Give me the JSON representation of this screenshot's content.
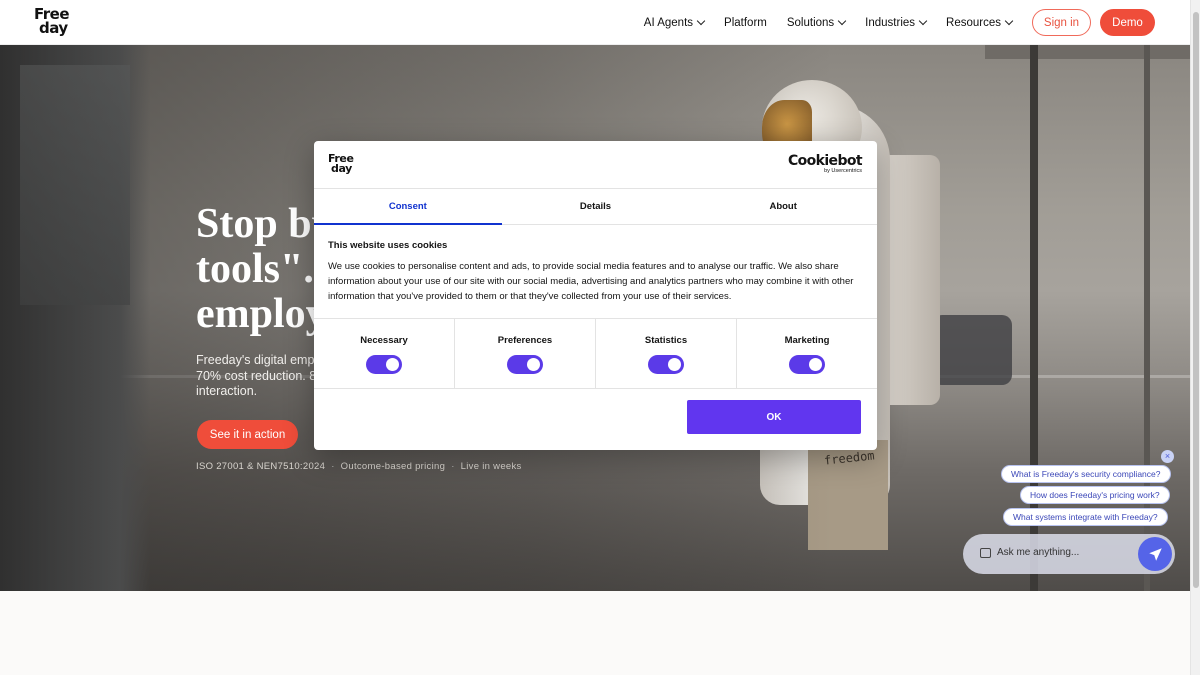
{
  "brand": {
    "line1": "Free",
    "line2": "day"
  },
  "nav": {
    "items": [
      {
        "label": "AI Agents",
        "dropdown": true
      },
      {
        "label": "Platform",
        "dropdown": false
      },
      {
        "label": "Solutions",
        "dropdown": true
      },
      {
        "label": "Industries",
        "dropdown": true
      },
      {
        "label": "Resources",
        "dropdown": true
      }
    ],
    "signin": "Sign in",
    "demo": "Demo"
  },
  "hero": {
    "title": "Stop bu\ntools\". F\nemploy",
    "subtitle": "Freeday's digital emplo\n70% cost reduction. 85\ninteraction.",
    "cta": "See it in action",
    "badges": [
      "ISO 27001 & NEN7510:2024",
      "Outcome-based pricing",
      "Live in weeks"
    ],
    "badge_separator": "·",
    "bag_text": "freedom"
  },
  "chat": {
    "close": "×",
    "suggestions": [
      "What is Freeday's security compliance?",
      "How does Freeday's pricing work?",
      "What systems integrate with Freeday?"
    ],
    "placeholder": "Ask me anything..."
  },
  "cookie_dialog": {
    "logo": {
      "line1": "Free",
      "line2": "day"
    },
    "provider": {
      "name": "Cookiebot",
      "sub": "by Usercentrics"
    },
    "tabs": [
      "Consent",
      "Details",
      "About"
    ],
    "active_tab": "Consent",
    "heading": "This website uses cookies",
    "text": "We use cookies to personalise content and ads, to provide social media features and to analyse our traffic. We also share information about your use of our site with our social media, advertising and analytics partners who may combine it with other information that you've provided to them or that they've collected from your use of their services.",
    "categories": [
      {
        "label": "Necessary",
        "enabled": true
      },
      {
        "label": "Preferences",
        "enabled": true
      },
      {
        "label": "Statistics",
        "enabled": true
      },
      {
        "label": "Marketing",
        "enabled": true
      }
    ],
    "ok": "OK"
  },
  "colors": {
    "accent": "#ef4d3a",
    "toggle": "#5b3ae8",
    "ok_button": "#6136ef",
    "tab_active": "#1032cf"
  }
}
